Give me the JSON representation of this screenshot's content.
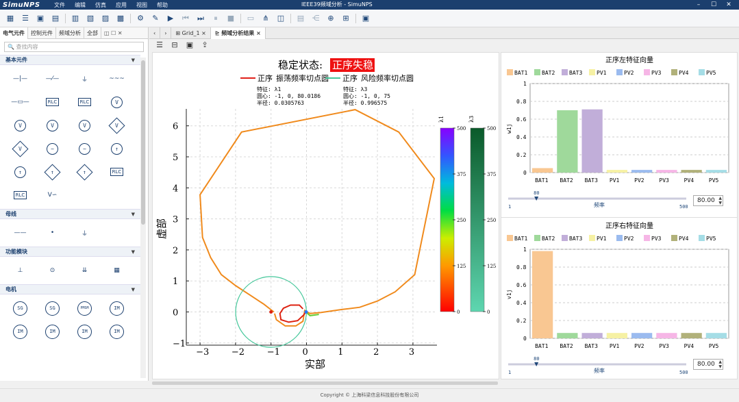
{
  "app": {
    "logo": "SimuNPS",
    "title": "IEEE39频域分析 - SimuNPS",
    "menu": [
      "文件",
      "编辑",
      "仿真",
      "应用",
      "视图",
      "帮助"
    ],
    "window_controls": [
      "–",
      "☐",
      "✕"
    ]
  },
  "toolbar_icons": [
    "grid-icon",
    "list-icon",
    "save-icon",
    "save-as-icon",
    "open-icon",
    "new-doc-icon",
    "import-icon",
    "export-icon",
    "settings-icon",
    "edit-icon",
    "run-icon",
    "step-back-icon",
    "step-forward-icon",
    "pause-icon",
    "stop-icon",
    "monitor-icon",
    "scope-icon",
    "waveform-icon",
    "table-icon",
    "network-icon",
    "node-icon",
    "layout-icon",
    "calc-icon"
  ],
  "left_panel": {
    "tabs": [
      "电气元件",
      "控制元件",
      "频域分析",
      "全部"
    ],
    "search_placeholder": "查找内容",
    "sections": [
      {
        "title": "基本元件",
        "items": [
          "—|—",
          "—⁄—",
          "⏚",
          "~~~",
          "—▭—",
          "RLC",
          "RLC",
          "V",
          "V",
          "V",
          "V",
          "V",
          "V",
          "~",
          "~",
          "↑",
          "↑",
          "↑",
          "↑",
          "RLC",
          "RLC",
          "V∽"
        ]
      },
      {
        "title": "母线",
        "items": [
          "——",
          "•",
          "⏚"
        ]
      },
      {
        "title": "功能模块",
        "items": [
          "⊥",
          "⊙",
          "⇊",
          "▦"
        ]
      },
      {
        "title": "电机",
        "items": [
          "SG",
          "SG",
          "PMSM",
          "IM",
          "IM",
          "IM",
          "IM",
          "IM"
        ]
      }
    ]
  },
  "doc_tabs": [
    {
      "label": "Grid_1",
      "close": "×"
    },
    {
      "label": "频域分析结果",
      "close": "×"
    }
  ],
  "nyquist": {
    "status_label": "稳定状态:",
    "status_value": "正序失稳",
    "legend": [
      {
        "prefix": "正序",
        "label": "振荡频率切点圆",
        "color": "#e0201a"
      },
      {
        "prefix": "正序",
        "label": "风险频率切点圆",
        "color": "#44c79a"
      }
    ],
    "info": [
      {
        "feature": "特征: λ1",
        "center": "圆心: -1, 0, 80.0186",
        "radius": "半径: 0.0305763"
      },
      {
        "feature": "特征: λ3",
        "center": "圆心: -1, 0, 75",
        "radius": "半径: 0.996575"
      }
    ],
    "xlabel": "实部",
    "ylabel": "虚部",
    "xticks": [
      "−3",
      "−2",
      "−1",
      "0",
      "1",
      "2",
      "3"
    ],
    "yticks": [
      "−1",
      "0",
      "1",
      "2",
      "3",
      "4",
      "5",
      "6"
    ],
    "colorbars": [
      {
        "title": "λ1",
        "ticks": [
          "500",
          "375",
          "250",
          "125",
          "0"
        ]
      },
      {
        "title": "λ3",
        "ticks": [
          "500",
          "375",
          "250",
          "125",
          "0"
        ]
      }
    ]
  },
  "chart_data": [
    {
      "type": "bar",
      "title": "正序左特征向量",
      "ylabel": "w1j",
      "categories": [
        "BAT1",
        "BAT2",
        "BAT3",
        "PV1",
        "PV2",
        "PV3",
        "PV4",
        "PV5"
      ],
      "values": [
        0.05,
        0.7,
        0.71,
        0.03,
        0.03,
        0.03,
        0.03,
        0.03
      ],
      "colors": [
        "#f9c792",
        "#9fd99b",
        "#c1aed9",
        "#f6f1a4",
        "#9bbbef",
        "#f6b6e6",
        "#b1b17a",
        "#a5dde6"
      ],
      "ylim": [
        0,
        1
      ],
      "yticks": [
        "0",
        "0.2",
        "0.4",
        "0.6",
        "0.8",
        "1"
      ],
      "legend_position": "top",
      "slider": {
        "min": "1",
        "max": "500",
        "value": "80",
        "label": "频率",
        "spin_value": "80.00"
      }
    },
    {
      "type": "bar",
      "title": "正序右特征向量",
      "ylabel": "v1j",
      "categories": [
        "BAT1",
        "BAT2",
        "BAT3",
        "PV1",
        "PV2",
        "PV3",
        "PV4",
        "PV5"
      ],
      "values": [
        0.98,
        0.06,
        0.06,
        0.06,
        0.06,
        0.06,
        0.06,
        0.06
      ],
      "colors": [
        "#f9c792",
        "#9fd99b",
        "#c1aed9",
        "#f6f1a4",
        "#9bbbef",
        "#f6b6e6",
        "#b1b17a",
        "#a5dde6"
      ],
      "ylim": [
        0,
        1
      ],
      "yticks": [
        "0",
        "0.2",
        "0.4",
        "0.6",
        "0.8",
        "1"
      ],
      "legend_position": "top",
      "slider": {
        "min": "1",
        "max": "500",
        "value": "80",
        "label": "频率",
        "spin_value": "80.00"
      }
    }
  ],
  "footer": "Copyright © 上海科梁信息科技股份有限公司"
}
